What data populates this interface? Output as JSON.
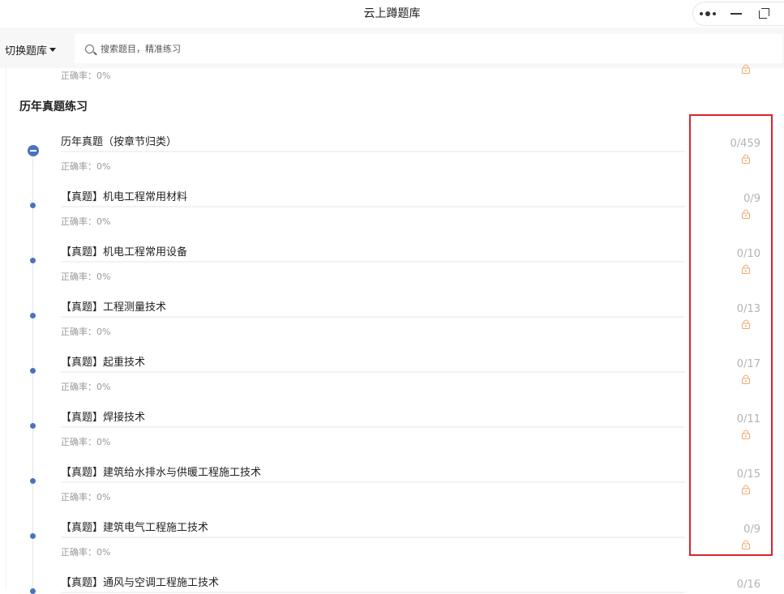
{
  "window": {
    "title": "云上蹲题库"
  },
  "topbar": {
    "switch_label": "切换题库",
    "search_placeholder": "搜索题目，精准练习"
  },
  "previous_item": {
    "accuracy": "正确率：0%"
  },
  "section": {
    "title": "历年真题练习",
    "items": [
      {
        "title": "历年真题（按章节归类）",
        "accuracy": "正确率：0%",
        "count": "0/459"
      },
      {
        "title": "【真题】机电工程常用材料",
        "accuracy": "正确率：0%",
        "count": "0/9"
      },
      {
        "title": "【真题】机电工程常用设备",
        "accuracy": "正确率：0%",
        "count": "0/10"
      },
      {
        "title": "【真题】工程测量技术",
        "accuracy": "正确率：0%",
        "count": "0/13"
      },
      {
        "title": "【真题】起重技术",
        "accuracy": "正确率：0%",
        "count": "0/17"
      },
      {
        "title": "【真题】焊接技术",
        "accuracy": "正确率：0%",
        "count": "0/11"
      },
      {
        "title": "【真题】建筑给水排水与供暖工程施工技术",
        "accuracy": "正确率：0%",
        "count": "0/15"
      },
      {
        "title": "【真题】建筑电气工程施工技术",
        "accuracy": "正确率：0%",
        "count": "0/9"
      },
      {
        "title": "【真题】通风与空调工程施工技术",
        "accuracy": "",
        "count": "0/16"
      }
    ]
  },
  "icons": {
    "lock": "lock-icon",
    "expand": "collapse-circle-icon",
    "menu": "more-dots-icon"
  },
  "colors": {
    "accent_blue": "#4a72c0",
    "lock_orange": "#f0a86a",
    "highlight_red": "#d9242b",
    "count_gray": "#b3b3b3"
  }
}
